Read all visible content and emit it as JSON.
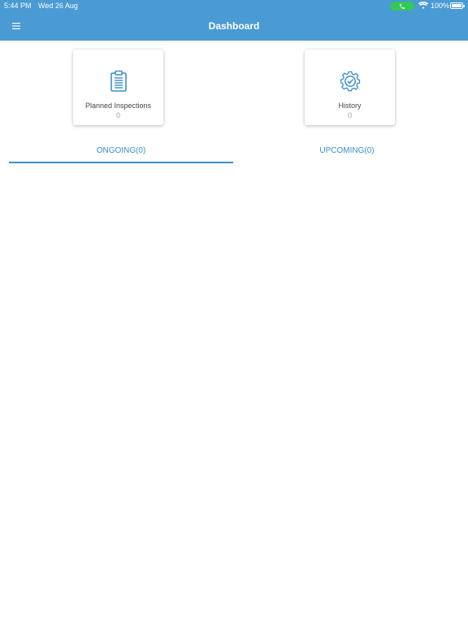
{
  "status_bar": {
    "time": "5:44 PM",
    "date": "Wed 26 Aug",
    "battery": "100%"
  },
  "header": {
    "title": "Dashboard",
    "menu_icon": "hamburger-menu-icon"
  },
  "cards": [
    {
      "label": "Planned Inspections",
      "count": "0",
      "icon": "clipboard-icon"
    },
    {
      "label": "History",
      "count": "0",
      "icon": "gear-check-icon"
    }
  ],
  "tabs": [
    {
      "label": "ONGOING(0)",
      "selected": true
    },
    {
      "label": "UPCOMING(0)",
      "selected": false
    }
  ],
  "colors": {
    "header": "#4a9ad4",
    "accent": "#3b8fc6",
    "call": "#34c759"
  }
}
